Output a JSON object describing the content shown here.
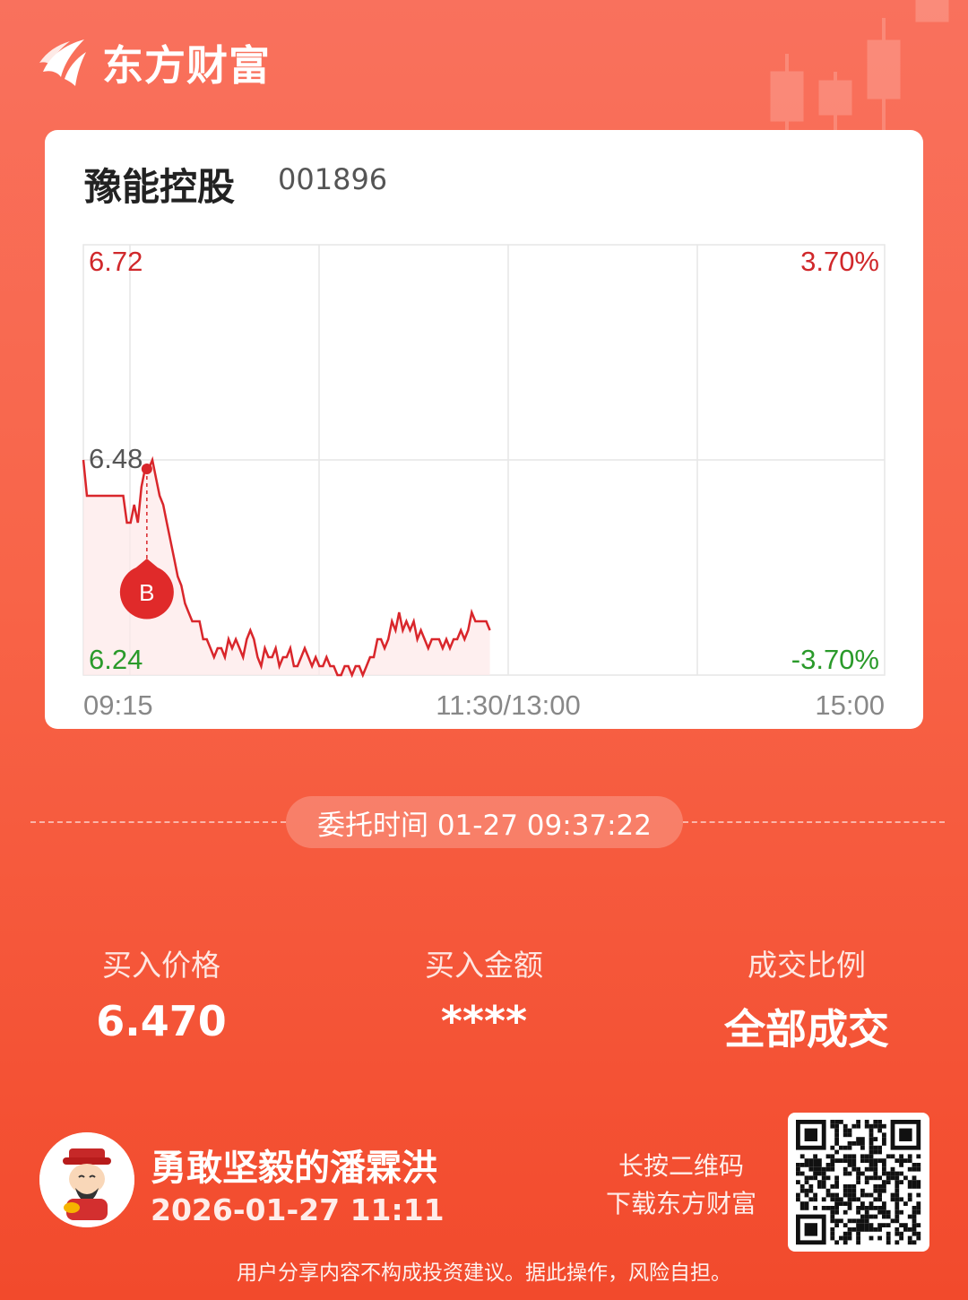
{
  "brand": {
    "name": "东方财富",
    "logo_icon": "east-money-logo-icon"
  },
  "stock": {
    "name": "豫能控股",
    "code": "001896"
  },
  "chart_data": {
    "type": "line",
    "y_left_labels": {
      "top": "6.72",
      "mid": "6.48",
      "bottom": "6.24"
    },
    "y_right_labels": {
      "top": "3.70%",
      "bottom": "-3.70%"
    },
    "x_labels": [
      "09:15",
      "11:30/13:00",
      "15:00"
    ],
    "ylim": [
      6.24,
      6.72
    ],
    "reference_price": 6.48,
    "colors": {
      "up": "#d0282b",
      "down": "#2a9a2a",
      "line": "#d9262b",
      "neutral": "#555555"
    },
    "series": [
      {
        "values": [
          6.48,
          6.44,
          6.44,
          6.44,
          6.44,
          6.44,
          6.44,
          6.44,
          6.44,
          6.44,
          6.44,
          6.44,
          6.41,
          6.41,
          6.43,
          6.41,
          6.45,
          6.47,
          6.47,
          6.48,
          6.46,
          6.44,
          6.43,
          6.41,
          6.39,
          6.37,
          6.35,
          6.34,
          6.32,
          6.31,
          6.3,
          6.3,
          6.3,
          6.28,
          6.28,
          6.27,
          6.26,
          6.27,
          6.27,
          6.26,
          6.28,
          6.27,
          6.28,
          6.27,
          6.26,
          6.28,
          6.29,
          6.28,
          6.26,
          6.25,
          6.27,
          6.26,
          6.26,
          6.27,
          6.25,
          6.26,
          6.26,
          6.27,
          6.25,
          6.25,
          6.26,
          6.27,
          6.26,
          6.25,
          6.26,
          6.25,
          6.25,
          6.26,
          6.25,
          6.25,
          6.24,
          6.24,
          6.25,
          6.25,
          6.24,
          6.25,
          6.25,
          6.24,
          6.25,
          6.26,
          6.26,
          6.28,
          6.28,
          6.27,
          6.28,
          6.3,
          6.29,
          6.31,
          6.29,
          6.3,
          6.29,
          6.3,
          6.28,
          6.29,
          6.28,
          6.27,
          6.28,
          6.28,
          6.28,
          6.27,
          6.28,
          6.27,
          6.28,
          6.28,
          6.29,
          6.28,
          6.29,
          6.31,
          6.3,
          6.3,
          6.3,
          6.3,
          6.29
        ]
      }
    ],
    "buy_marker": {
      "label": "B",
      "x_index": 17,
      "price": 6.47
    }
  },
  "order_time": "委托时间 01-27 09:37:22",
  "stats": [
    {
      "label": "买入价格",
      "value": "6.470"
    },
    {
      "label": "买入金额",
      "value": "****"
    },
    {
      "label": "成交比例",
      "value": "全部成交"
    }
  ],
  "user": {
    "name": "勇敢坚毅的潘霖洪",
    "time": "2026-01-27 11:11",
    "avatar_icon": "god-of-wealth-avatar-icon"
  },
  "qr": {
    "hint_line1": "长按二维码",
    "hint_line2": "下载东方财富",
    "icon": "qr-code-icon"
  },
  "disclaimer": "用户分享内容不构成投资建议。据此操作，风险自担。"
}
